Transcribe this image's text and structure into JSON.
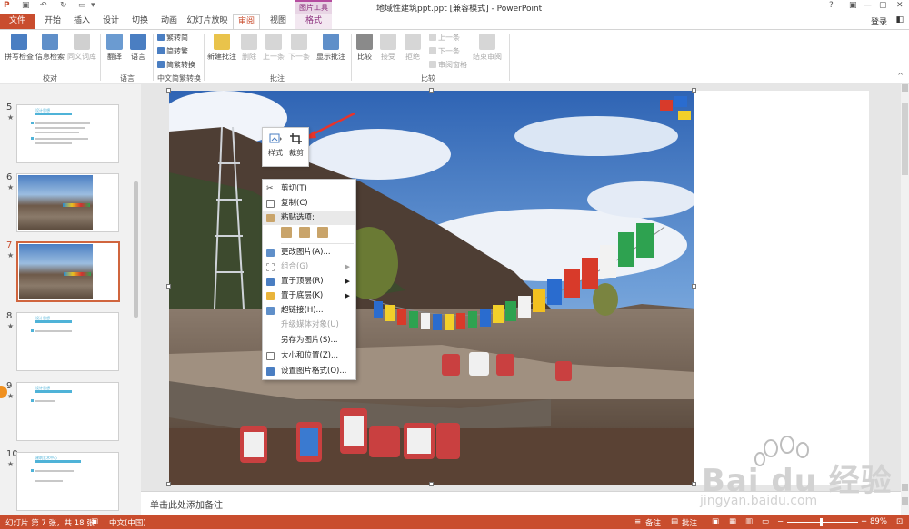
{
  "window": {
    "title": "地域性建筑ppt.ppt [兼容模式] - PowerPoint",
    "context_tab_group": "图片工具",
    "help": "?",
    "minimize": "—",
    "restore": "▢",
    "close": "✕"
  },
  "tabs": {
    "file": "文件",
    "items": [
      "开始",
      "插入",
      "设计",
      "切换",
      "动画",
      "幻灯片放映",
      "审阅",
      "视图",
      "格式"
    ],
    "active": "审阅",
    "login": "登录"
  },
  "ribbon": {
    "proofing": {
      "label": "校对",
      "spelling": "拼写检查",
      "research": "信息检索",
      "thesaurus": "同义词库"
    },
    "language": {
      "label": "语言",
      "translate": "翻译",
      "language": "语言"
    },
    "chinese_conversion": {
      "label": "中文简繁转换",
      "to_simplified": "繁转简",
      "to_traditional": "简转繁",
      "conversion": "简繁转换"
    },
    "comments": {
      "label": "批注",
      "new": "新建批注",
      "delete": "删除",
      "prev": "上一条",
      "next": "下一条",
      "show": "显示批注"
    },
    "compare": {
      "label": "比较",
      "compare": "比较",
      "accept": "接受",
      "reject": "拒绝",
      "prev": "上一条",
      "next": "下一条",
      "review_pane": "审阅窗格",
      "end_review": "结束审阅"
    }
  },
  "thumbnails": [
    {
      "num": "5",
      "kind": "text",
      "title": "设计思想"
    },
    {
      "num": "6",
      "kind": "photo"
    },
    {
      "num": "7",
      "kind": "photo",
      "selected": true
    },
    {
      "num": "8",
      "kind": "text",
      "title": "设计思想"
    },
    {
      "num": "9",
      "kind": "text",
      "title": "设计思想"
    },
    {
      "num": "10",
      "kind": "text",
      "title": "建筑艺术中心"
    }
  ],
  "minitoolbar": {
    "style": "样式",
    "crop": "裁剪"
  },
  "context_menu": {
    "cut": "剪切(T)",
    "copy": "复制(C)",
    "paste_options": "粘贴选项:",
    "change_picture": "更改图片(A)...",
    "group": "组合(G)",
    "bring_to_front": "置于顶层(R)",
    "send_to_back": "置于底层(K)",
    "hyperlink": "超链接(H)...",
    "upgrade_media": "升级媒体对象(U)",
    "save_as_picture": "另存为图片(S)...",
    "size_position": "大小和位置(Z)...",
    "format_picture": "设置图片格式(O)..."
  },
  "notes": {
    "placeholder": "单击此处添加备注"
  },
  "statusbar": {
    "slide_info": "幻灯片 第 7 张，共 18 张",
    "language": "中文(中国)",
    "notes": "备注",
    "comments": "批注",
    "zoom": "89%"
  },
  "watermark": {
    "brand": "Bai du 经验",
    "url": "jingyan.baidu.com"
  },
  "colors": {
    "accent": "#c94d2e",
    "context": "#8b2f7d"
  }
}
